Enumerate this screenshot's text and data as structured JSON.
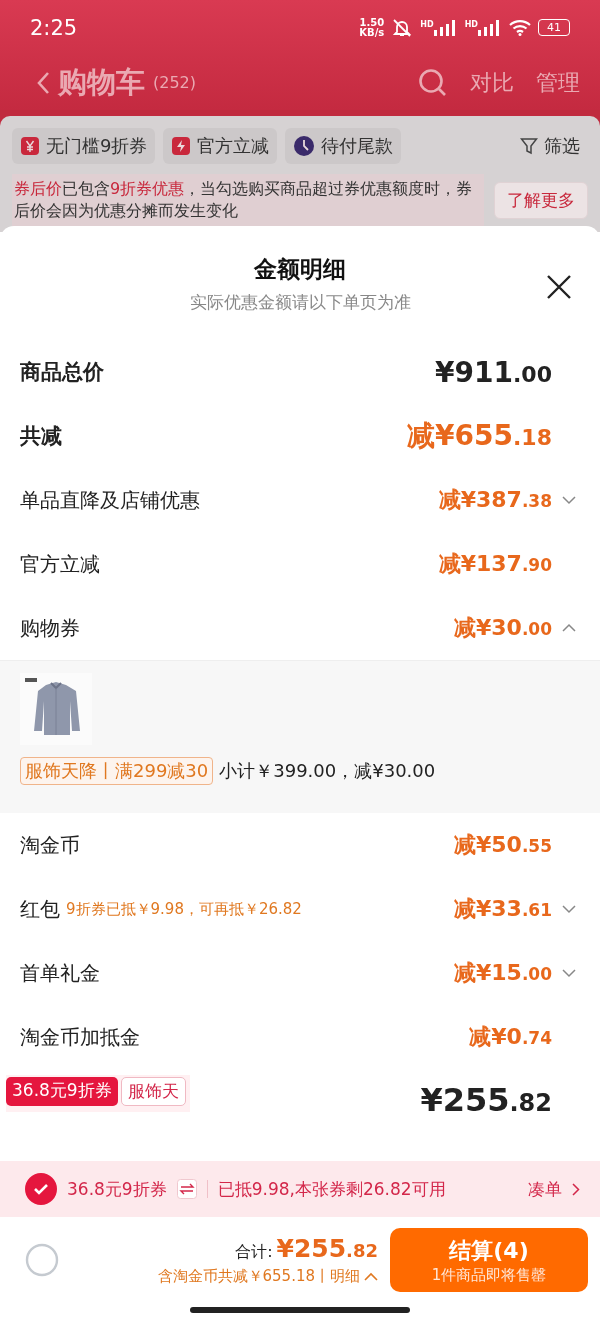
{
  "status_bar": {
    "time": "2:25",
    "speed_value": "1.50",
    "speed_unit": "KB/s",
    "sim_labels": [
      "HD",
      "HD"
    ],
    "battery": "41"
  },
  "header": {
    "title": "购物车",
    "count": "(252)",
    "actions": [
      "对比",
      "管理"
    ]
  },
  "filters": [
    {
      "label": "无门槛9折券",
      "kind": "coupon"
    },
    {
      "label": "官方立减",
      "kind": "bolt"
    },
    {
      "label": "待付尾款",
      "kind": "clock"
    },
    {
      "label": "筛选",
      "kind": "funnel"
    }
  ],
  "notice": {
    "parts": [
      {
        "text": "券后价",
        "highlight": true
      },
      {
        "text": "已包含",
        "highlight": false
      },
      {
        "text": "9折券优惠",
        "highlight": true
      },
      {
        "text": "，当勾选购买商品超过券优惠额度时，券后价会因为优惠分摊而发生变化",
        "highlight": false
      }
    ],
    "button": "了解更多"
  },
  "sheet": {
    "title": "金额明细",
    "subtitle": "实际优惠金额请以下单页为准",
    "rows": [
      {
        "kind": "total",
        "label": "商品总价",
        "main": "¥911",
        "cents": ".00"
      },
      {
        "kind": "sum",
        "label": "共减",
        "main": "减¥655",
        "cents": ".18"
      },
      {
        "kind": "item",
        "label": "单品直降及店铺优惠",
        "main": "减¥387",
        "cents": ".38",
        "expanded": false
      },
      {
        "kind": "item",
        "label": "官方立减",
        "main": "减¥137",
        "cents": ".90"
      },
      {
        "kind": "item",
        "label": "购物券",
        "main": "减¥30",
        "cents": ".00",
        "expanded": true,
        "detail": {
          "tag": "服饰天降丨满299减30",
          "text": "小计￥399.00，减¥30.00"
        }
      },
      {
        "kind": "item",
        "label": "淘金币",
        "main": "减¥50",
        "cents": ".55"
      },
      {
        "kind": "item",
        "label": "红包",
        "note": "9折券已抵￥9.98，可再抵￥26.82",
        "main": "减¥33",
        "cents": ".61",
        "expanded": false
      },
      {
        "kind": "item",
        "label": "首单礼金",
        "main": "减¥15",
        "cents": ".00",
        "expanded": false
      },
      {
        "kind": "item",
        "label": "淘金币加抵金",
        "main": "减¥0",
        "cents": ".74"
      },
      {
        "kind": "final",
        "main": "¥255",
        "cents": ".82",
        "badges": [
          "36.8元9折券",
          "服饰天"
        ]
      }
    ]
  },
  "coupon_bar": {
    "checked": true,
    "name": "36.8元9折券",
    "info": "已抵9.98,本张券剩26.82可用",
    "link": "凑单"
  },
  "footer": {
    "select_all": false,
    "total_label": "合计:",
    "total_main": "¥255",
    "total_cents": ".82",
    "saving": "含淘金币共减￥655.18丨明细",
    "checkout": "结算(4)",
    "checkout_note": "1件商品即将售罄"
  }
}
